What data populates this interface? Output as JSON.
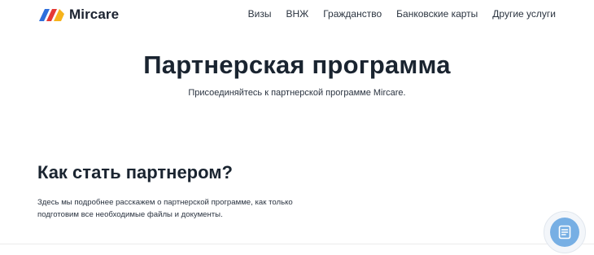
{
  "header": {
    "logo_text": "Mircare",
    "nav": [
      {
        "label": "Визы"
      },
      {
        "label": "ВНЖ"
      },
      {
        "label": "Гражданство"
      },
      {
        "label": "Банковские карты"
      },
      {
        "label": "Другие услуги"
      }
    ]
  },
  "hero": {
    "title": "Партнерская программа",
    "subtitle": "Присоединяйтесь к партнерской программе Mircare."
  },
  "section": {
    "title": "Как стать партнером?",
    "text": "Здесь мы подробнее расскажем о партнерской программе, как только подготовим все необходимые файлы и документы."
  },
  "widget": {
    "icon": "document-icon",
    "color": "#77afe4"
  },
  "logo_colors": [
    "#2f6fdc",
    "#e53935",
    "#f6b31b"
  ]
}
